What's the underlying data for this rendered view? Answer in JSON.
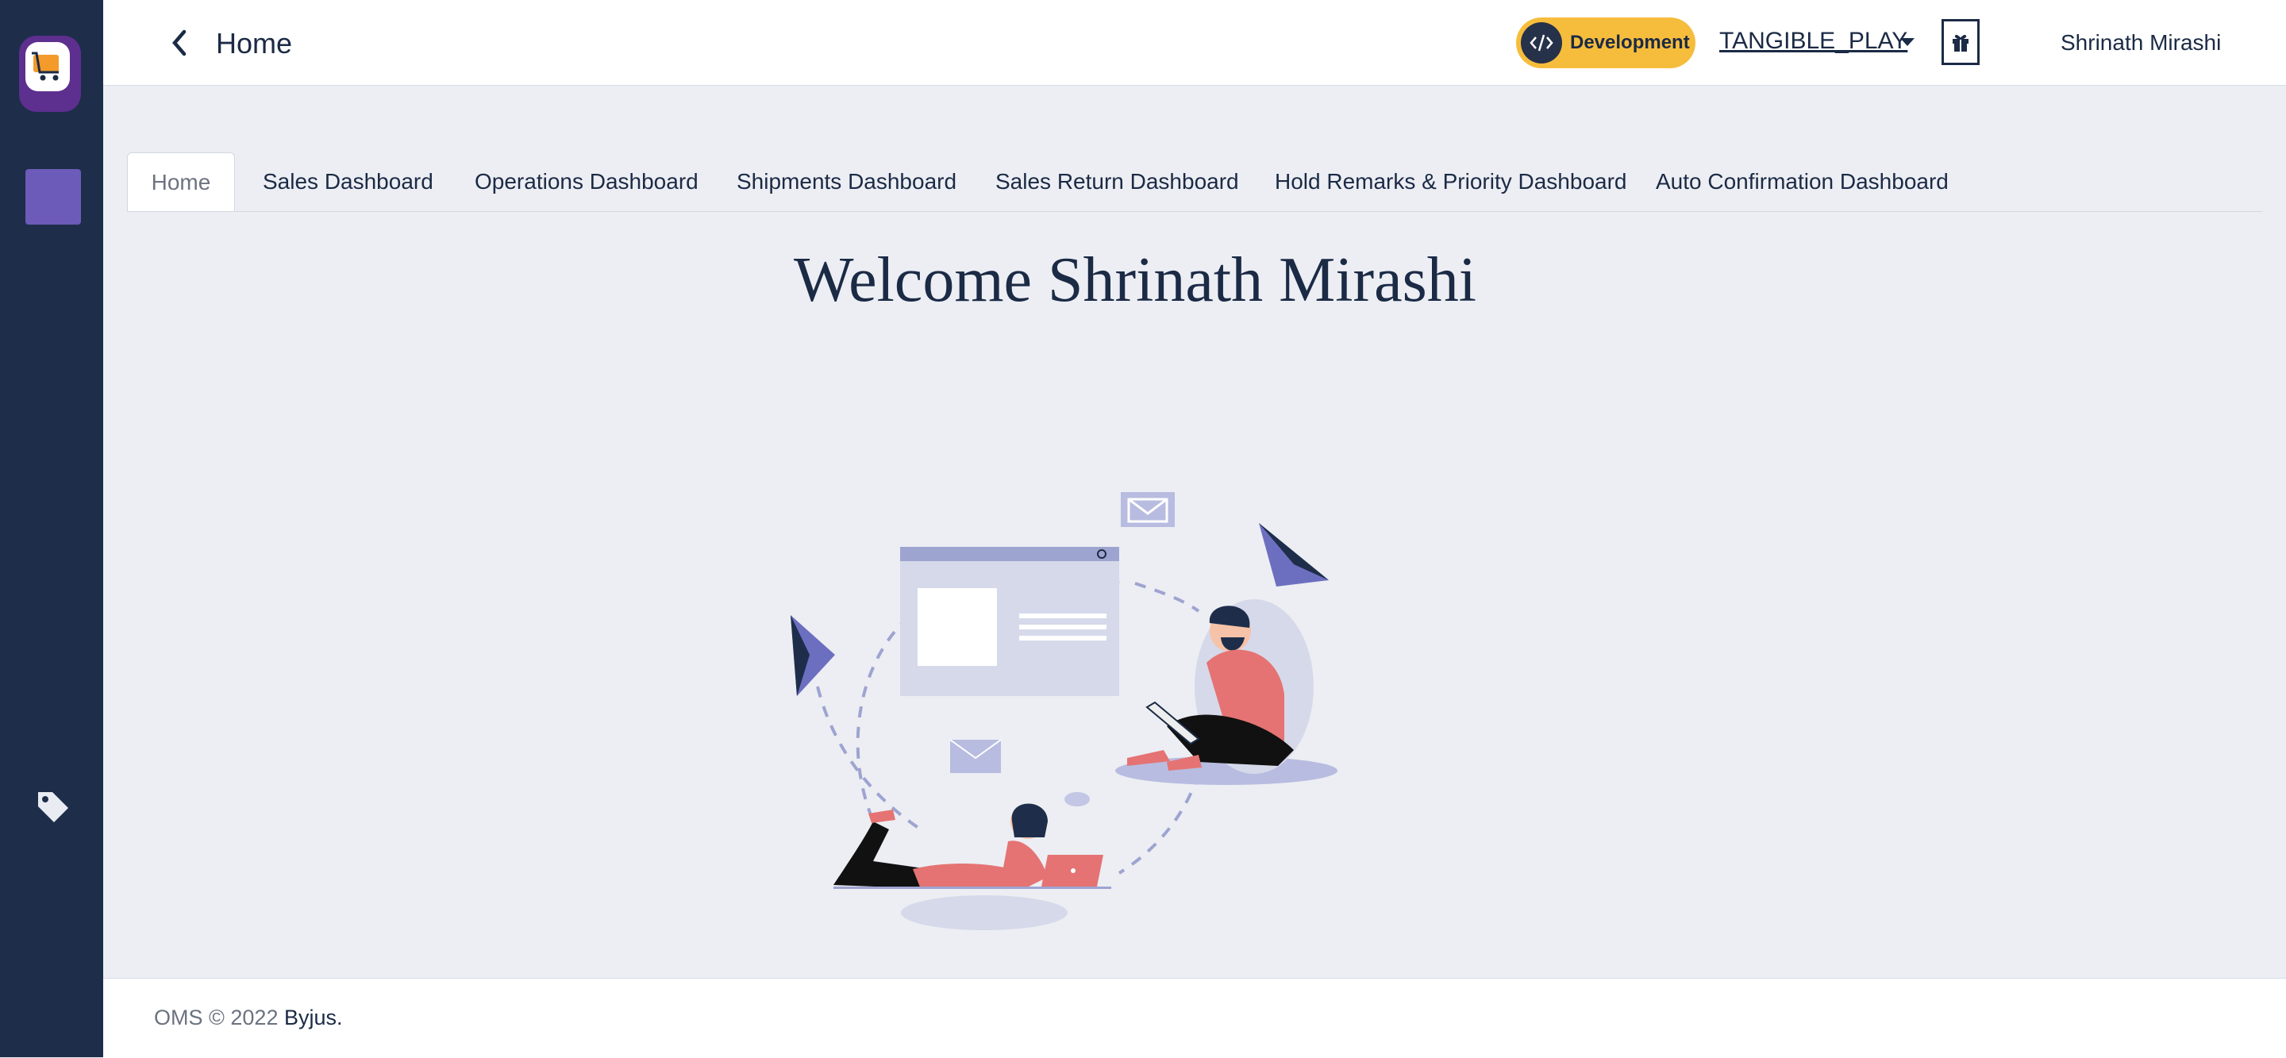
{
  "sidebar": {
    "logo_icon": "app-logo-cart-icon",
    "nav_item_icon": "menu-square-icon",
    "tag_icon": "tag-icon",
    "colors": {
      "background": "#1e2e4a",
      "accent": "#6c5bb8"
    }
  },
  "header": {
    "back_icon": "chevron-left-icon",
    "title": "Home",
    "environment": {
      "label": "Development",
      "icon": "code-icon",
      "color": "#f6bd3c"
    },
    "organization": "TANGIBLE_PLAY",
    "gift_icon": "gift-icon",
    "user_name": "Shrinath Mirashi"
  },
  "tabs": [
    {
      "label": "Home",
      "active": true
    },
    {
      "label": "Sales Dashboard",
      "active": false
    },
    {
      "label": "Operations Dashboard",
      "active": false
    },
    {
      "label": "Shipments Dashboard",
      "active": false
    },
    {
      "label": "Sales Return Dashboard",
      "active": false
    },
    {
      "label": "Hold Remarks & Priority Dashboard",
      "active": false
    },
    {
      "label": "Auto Confirmation Dashboard",
      "active": false
    }
  ],
  "main": {
    "welcome": "Welcome Shrinath Mirashi"
  },
  "footer": {
    "copyright": "OMS © 2022 ",
    "link": "Byjus."
  }
}
